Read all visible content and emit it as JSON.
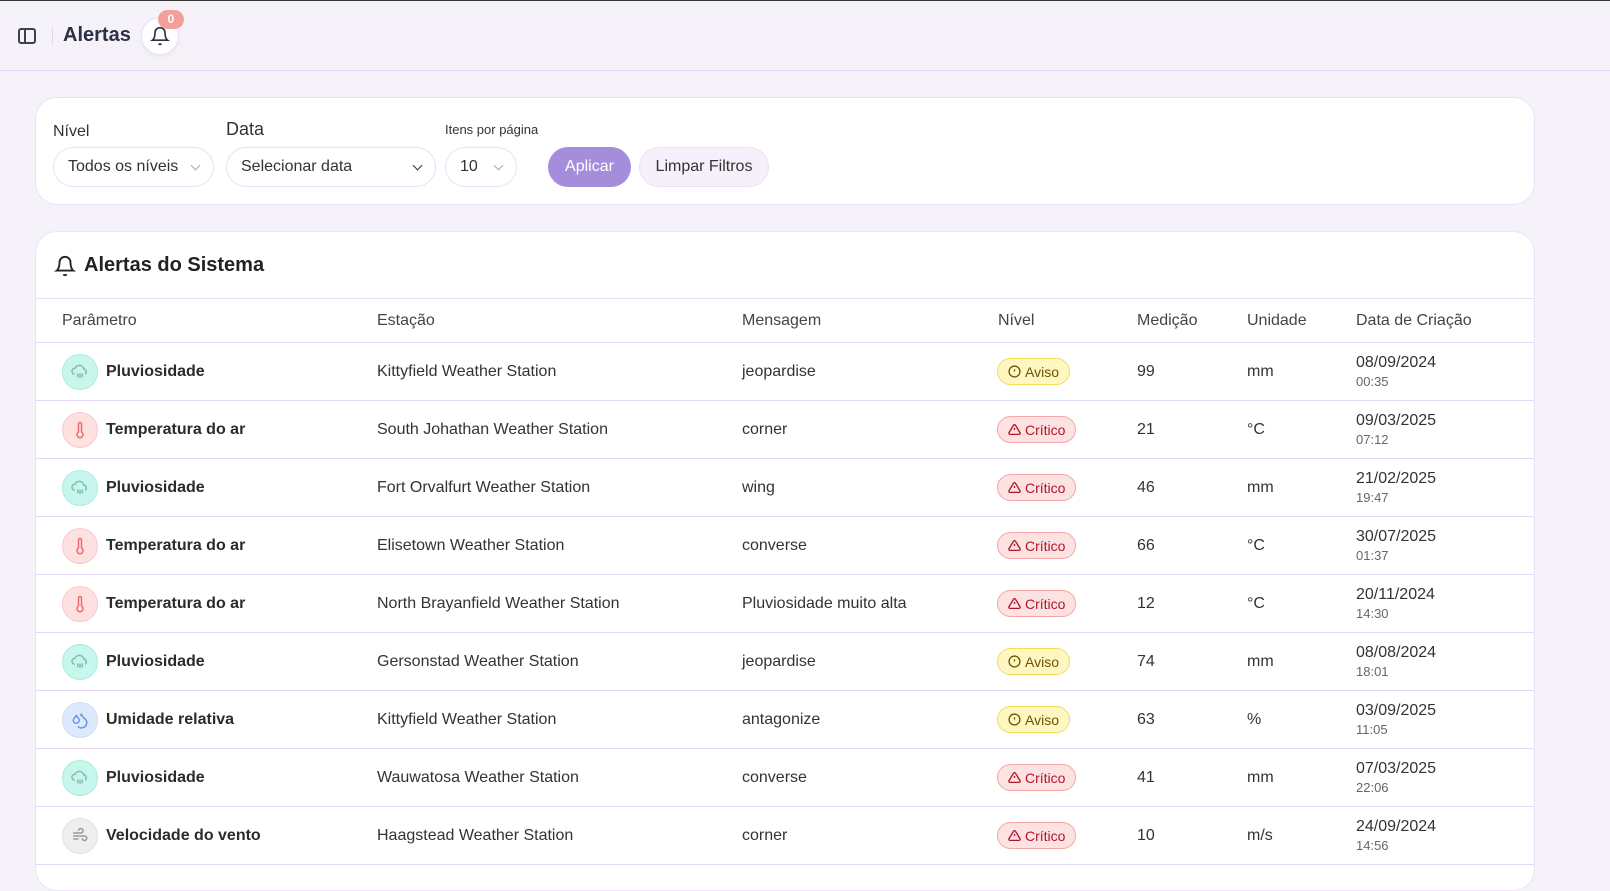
{
  "header": {
    "title": "Alertas",
    "notification_count": "0"
  },
  "filters": {
    "nivel_label": "Nível",
    "nivel_value": "Todos os níveis",
    "data_label": "Data",
    "data_value": "Selecionar data",
    "itens_label": "Itens por página",
    "itens_value": "10",
    "apply": "Aplicar",
    "clear": "Limpar Filtros"
  },
  "table": {
    "title": "Alertas do Sistema",
    "columns": [
      "Parâmetro",
      "Estação",
      "Mensagem",
      "Nível",
      "Medição",
      "Unidade",
      "Data de Criação"
    ],
    "rows": [
      {
        "param": "Pluviosidade",
        "type": "rain",
        "station": "Kittyfield Weather Station",
        "message": "jeopardise",
        "level": "Aviso",
        "value": "99",
        "unit": "mm",
        "date": "08/09/2024",
        "time": "00:35"
      },
      {
        "param": "Temperatura do ar",
        "type": "temp",
        "station": "South Johathan Weather Station",
        "message": "corner",
        "level": "Crítico",
        "value": "21",
        "unit": "°C",
        "date": "09/03/2025",
        "time": "07:12"
      },
      {
        "param": "Pluviosidade",
        "type": "rain",
        "station": "Fort Orvalfurt Weather Station",
        "message": "wing",
        "level": "Crítico",
        "value": "46",
        "unit": "mm",
        "date": "21/02/2025",
        "time": "19:47"
      },
      {
        "param": "Temperatura do ar",
        "type": "temp",
        "station": "Elisetown Weather Station",
        "message": "converse",
        "level": "Crítico",
        "value": "66",
        "unit": "°C",
        "date": "30/07/2025",
        "time": "01:37"
      },
      {
        "param": "Temperatura do ar",
        "type": "temp",
        "station": "North Brayanfield Weather Station",
        "message": "Pluviosidade muito alta",
        "level": "Crítico",
        "value": "12",
        "unit": "°C",
        "date": "20/11/2024",
        "time": "14:30"
      },
      {
        "param": "Pluviosidade",
        "type": "rain",
        "station": "Gersonstad Weather Station",
        "message": "jeopardise",
        "level": "Aviso",
        "value": "74",
        "unit": "mm",
        "date": "08/08/2024",
        "time": "18:01"
      },
      {
        "param": "Umidade relativa",
        "type": "humidity",
        "station": "Kittyfield Weather Station",
        "message": "antagonize",
        "level": "Aviso",
        "value": "63",
        "unit": "%",
        "date": "03/09/2025",
        "time": "11:05"
      },
      {
        "param": "Pluviosidade",
        "type": "rain",
        "station": "Wauwatosa Weather Station",
        "message": "converse",
        "level": "Crítico",
        "value": "41",
        "unit": "mm",
        "date": "07/03/2025",
        "time": "22:06"
      },
      {
        "param": "Velocidade do vento",
        "type": "wind",
        "station": "Haagstead Weather Station",
        "message": "corner",
        "level": "Crítico",
        "value": "10",
        "unit": "m/s",
        "date": "24/09/2024",
        "time": "14:56"
      }
    ]
  }
}
